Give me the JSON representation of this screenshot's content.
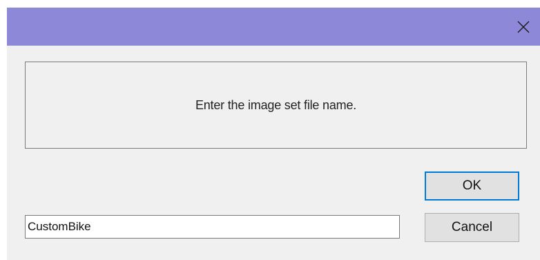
{
  "titlebar": {
    "close_icon": "close-icon",
    "color": "#8e88d8"
  },
  "message": {
    "text": "Enter the image set file name."
  },
  "buttons": {
    "ok_label": "OK",
    "cancel_label": "Cancel",
    "focus_color": "#0078d7"
  },
  "input": {
    "value": "CustomBike"
  }
}
